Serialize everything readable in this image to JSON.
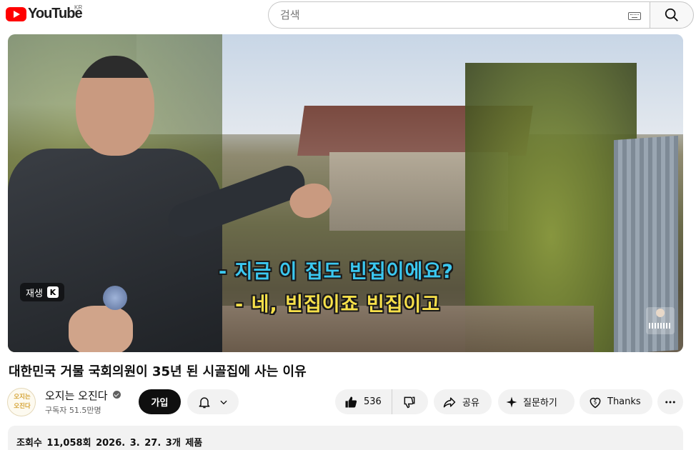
{
  "header": {
    "logo_text": "YouTube",
    "country_code": "KR",
    "search_placeholder": "검색",
    "icons": [
      "youtube-logo-icon",
      "keyboard-icon",
      "search-icon"
    ]
  },
  "video": {
    "subtitle_line1": "- 지금 이 집도 빈집이에요?",
    "subtitle_line2": "- 네, 빈집이죠 빈집이고",
    "replay_label": "재생",
    "replay_key": "K",
    "subtitle_colors": {
      "line1": "#3bc8f0",
      "line2": "#f7e04a"
    }
  },
  "meta": {
    "title": "대한민국 거물 국회의원이 35년 된 시골집에 사는 이유",
    "channel_name": "오지는 오진다",
    "avatar_text": "오지는\n오진다",
    "subscribers": "구독자 51.5만명",
    "join_label": "가입"
  },
  "actions": {
    "like_count": "536",
    "share_label": "공유",
    "ask_label": "질문하기",
    "thanks_label": "Thanks"
  },
  "description": {
    "views": "조회수 11,058회",
    "date": "2026. 3. 27.",
    "products": "3개 제품"
  }
}
